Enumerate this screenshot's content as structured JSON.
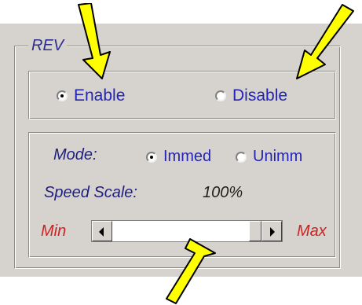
{
  "group": {
    "title": "REV"
  },
  "power": {
    "enable_label": "Enable",
    "disable_label": "Disable",
    "selected": "Enable"
  },
  "mode": {
    "label": "Mode:",
    "immed_label": "Immed",
    "unimm_label": "Unimm",
    "selected": "Immed"
  },
  "speed": {
    "label": "Speed Scale:",
    "value": "100%",
    "min_label": "Min",
    "max_label": "Max",
    "slider_fraction": 1.0
  },
  "colors": {
    "panel_bg": "#d6d3ce",
    "label_blue": "#2323b8",
    "label_navy": "#1f1f80",
    "label_red": "#cc2222",
    "annotation_arrow_fill": "#ffff00",
    "annotation_arrow_stroke": "#000000"
  },
  "annotations": [
    {
      "name": "arrow-to-enable"
    },
    {
      "name": "arrow-to-disable"
    },
    {
      "name": "arrow-to-slider"
    }
  ]
}
